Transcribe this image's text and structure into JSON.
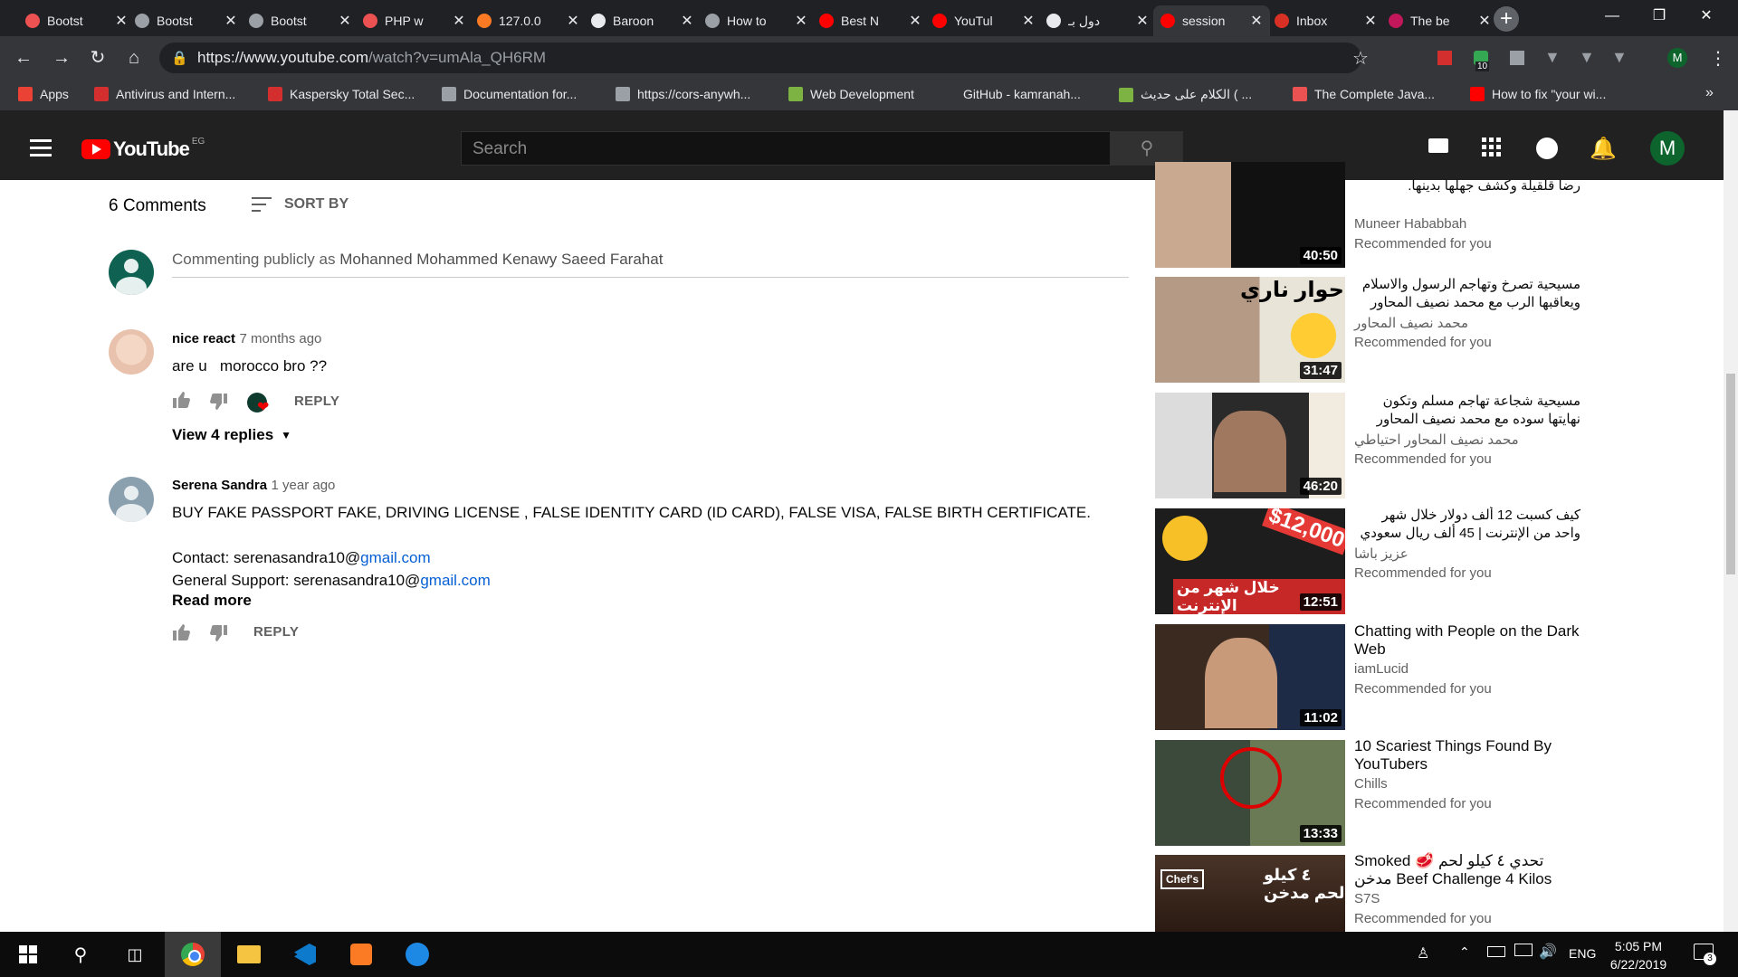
{
  "browser": {
    "tabs": [
      {
        "label": "Bootst",
        "icon": "udemy-icon",
        "color": "#ec5252"
      },
      {
        "label": "Bootst",
        "icon": "globe-icon",
        "color": "#9aa0a6"
      },
      {
        "label": "Bootst",
        "icon": "globe-icon",
        "color": "#9aa0a6"
      },
      {
        "label": "PHP w",
        "icon": "udemy-icon",
        "color": "#ec5252"
      },
      {
        "label": "127.0.0",
        "icon": "xampp-icon",
        "color": "#fb7a24"
      },
      {
        "label": "Baroon",
        "icon": "github-icon",
        "color": "#e8eaed"
      },
      {
        "label": "How to",
        "icon": "anchor-icon",
        "color": "#9aa0a6"
      },
      {
        "label": "Best N",
        "icon": "youtube-icon",
        "color": "#ff0000"
      },
      {
        "label": "YouTul",
        "icon": "youtube-icon",
        "color": "#ff0000"
      },
      {
        "label": "دول بـ",
        "icon": "article-icon",
        "color": "#e8eaed"
      },
      {
        "label": "session",
        "icon": "youtube-icon",
        "color": "#ff0000"
      },
      {
        "label": "Inbox",
        "icon": "gmail-icon",
        "color": "#d93025"
      },
      {
        "label": "The be",
        "icon": "puzzle-icon",
        "color": "#c2185b"
      }
    ],
    "active_tab_index": 10,
    "url_host": "https://www.youtube.com",
    "url_path": "/watch?v=umAla_QH6RM",
    "bookmarks": [
      {
        "label": "Apps",
        "color": "#ea4335"
      },
      {
        "label": "Antivirus and Intern...",
        "color": "#d32f2f"
      },
      {
        "label": "Kaspersky Total Sec...",
        "color": "#d32f2f"
      },
      {
        "label": "Documentation for...",
        "color": "#9aa0a6"
      },
      {
        "label": "https://cors-anywh...",
        "color": "#9aa0a6"
      },
      {
        "label": "Web Development",
        "color": "#7cb342"
      },
      {
        "label": "GitHub - kamranah...",
        "color": "#35363a"
      },
      {
        "label": "الكلام على حديث ( ...",
        "color": "#7cb342"
      },
      {
        "label": "The Complete Java...",
        "color": "#ec5252"
      },
      {
        "label": "How to fix \"your wi...",
        "color": "#ff0000"
      }
    ],
    "ext_badge": "10",
    "profile_letter": "M",
    "more_bookmarks": "»"
  },
  "youtube": {
    "logo_text": "YouTube",
    "region": "EG",
    "search_placeholder": "Search",
    "avatar_letter": "M",
    "brand_color": "#ff0000"
  },
  "comments_header": {
    "count": "6 Comments",
    "sort_label": "SORT BY",
    "commenting_prefix": "Commenting publicly as",
    "commenting_name": "Mohanned Mohammed Kenawy Saeed Farahat"
  },
  "comments": [
    {
      "author": "nice react",
      "time": "7 months ago",
      "text": "are u   morocco bro ??",
      "reply_label": "REPLY",
      "replies_label": "View 4 replies"
    },
    {
      "author": "Serena Sandra",
      "time": "1 year ago",
      "line1": "BUY FAKE PASSPORT FAKE, DRIVING LICENSE , FALSE IDENTITY CARD (ID CARD), FALSE VISA, FALSE BIRTH CERTIFICATE.",
      "contact_prefix": "Contact: serenasandra10@",
      "contact_link": "gmail.com",
      "support_prefix": "General Support: serenasandra10@",
      "support_link": "gmail.com",
      "read_more": "Read more",
      "reply_label": "REPLY"
    }
  ],
  "sidebar": [
    {
      "title": "رضا قلقيلة وكشف جهلها بدينها.",
      "channel": "Muneer Hababbah",
      "rec": "Recommended for you",
      "duration": "40:50"
    },
    {
      "title": "مسيحية تصرخ وتهاجم الرسول والاسلام ويعاقبها الرب مع محمد نصيف المحاور",
      "channel": "محمد نصيف المحاور",
      "rec": "Recommended for you",
      "duration": "31:47"
    },
    {
      "title": "مسيحية شجاعة تهاجم مسلم وتكون نهايتها سوده مع محمد نصيف المحاور",
      "channel": "محمد نصيف المحاور احتياطي",
      "rec": "Recommended for you",
      "duration": "46:20"
    },
    {
      "title": "كيف كسبت 12 ألف دولار خلال شهر واحد من الإنترنت | 45 ألف ريال سعودي 💰 | ...",
      "channel": "عزيز باشا",
      "rec": "Recommended for you",
      "duration": "12:51"
    },
    {
      "title": "Chatting with People on the Dark Web",
      "channel": "iamLucid",
      "rec": "Recommended for you",
      "duration": "11:02"
    },
    {
      "title": "10 Scariest Things Found By YouTubers",
      "channel": "Chills",
      "rec": "Recommended for you",
      "duration": "13:33"
    },
    {
      "title": "Smoked 🥩 تحدي ٤ كيلو لحم مدخن Beef Challenge 4 Kilos",
      "channel": "S7S",
      "rec": "Recommended for you",
      "duration": ""
    }
  ],
  "thumb_texts": {
    "t2": "حوار ناري",
    "t4": "$12,000",
    "t4b": "خلال شهر من الإنترنت",
    "t7": "٤ كيلو لحم مدخن",
    "t7logo": "Chef's"
  },
  "taskbar": {
    "time": "5:05 PM",
    "date": "6/22/2019",
    "lang": "ENG",
    "notif_count": "3"
  }
}
